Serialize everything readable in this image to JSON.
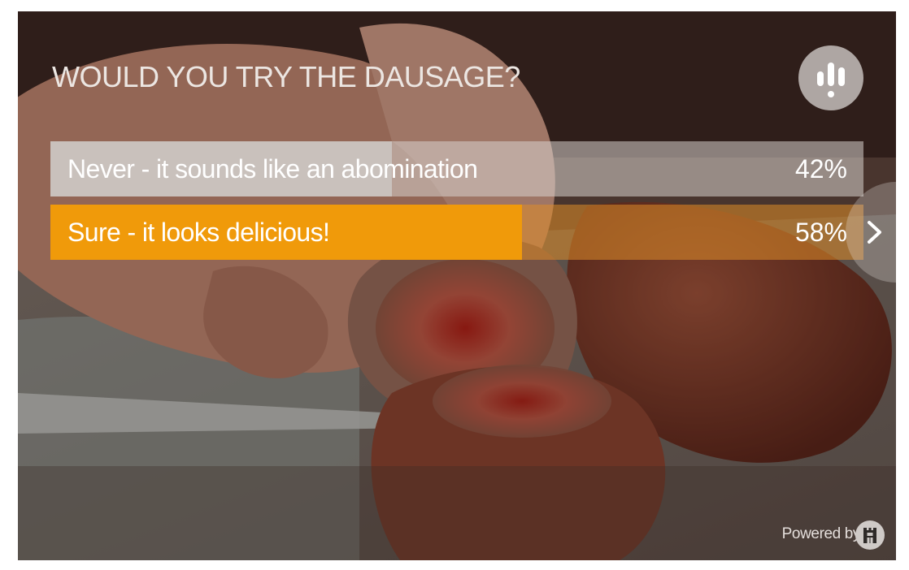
{
  "poll": {
    "question": "WOULD YOU TRY THE DAUSAGE?",
    "options": [
      {
        "label": "Never - it sounds like an abomination",
        "percent_label": "42%",
        "percent": 42
      },
      {
        "label": "Sure - it looks delicious!",
        "percent_label": "58%",
        "percent": 58,
        "selected": true
      }
    ]
  },
  "footer": {
    "powered_by": "Powered by"
  },
  "colors": {
    "selected_fill": "#f09a0a",
    "unselected_fill": "#cdc8c5",
    "text": "#ffffff"
  },
  "icons": {
    "header_logo": "poll-logo-icon",
    "next": "chevron-right-icon",
    "brand": "brand-badge-icon"
  },
  "background": {
    "subject": "sausage-photo"
  }
}
